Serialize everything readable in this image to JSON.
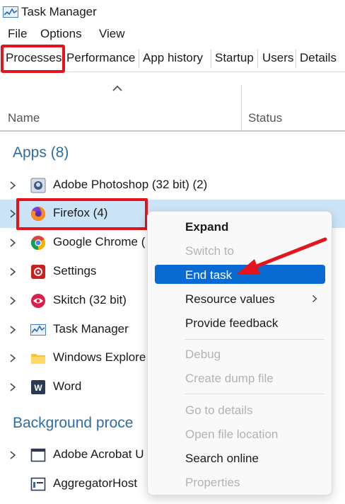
{
  "window": {
    "title": "Task Manager"
  },
  "menu": {
    "items": [
      "File",
      "Options",
      "View"
    ]
  },
  "tabs": [
    "Processes",
    "Performance",
    "App history",
    "Startup",
    "Users",
    "Details"
  ],
  "columns": {
    "name": "Name",
    "status": "Status"
  },
  "groups": {
    "apps": "Apps (8)",
    "background": "Background proce"
  },
  "apps": [
    {
      "label": "Adobe Photoshop (32 bit) (2)",
      "icon": "photoshop-icon"
    },
    {
      "label": "Firefox (4)",
      "icon": "firefox-icon"
    },
    {
      "label": "Google Chrome (",
      "icon": "chrome-icon"
    },
    {
      "label": "Settings",
      "icon": "settings-icon"
    },
    {
      "label": "Skitch (32 bit)",
      "icon": "skitch-icon"
    },
    {
      "label": "Task Manager",
      "icon": "task-manager-icon"
    },
    {
      "label": "Windows Explore",
      "icon": "folder-icon"
    },
    {
      "label": "Word",
      "icon": "word-icon"
    }
  ],
  "background": [
    {
      "label": "Adobe Acrobat U",
      "icon": "window-icon"
    },
    {
      "label": "AggregatorHost",
      "icon": "app-window-icon"
    }
  ],
  "context_menu": {
    "expand": "Expand",
    "switch_to": "Switch to",
    "end_task": "End task",
    "resource_values": "Resource values",
    "provide_feedback": "Provide feedback",
    "debug": "Debug",
    "create_dump": "Create dump file",
    "go_to_details": "Go to details",
    "open_file_location": "Open file location",
    "search_online": "Search online",
    "properties": "Properties"
  },
  "colors": {
    "accent": "#0a6ad4",
    "highlight_red": "#e3141b",
    "group_title": "#2e6da4",
    "selected_row": "#cce4f7"
  }
}
